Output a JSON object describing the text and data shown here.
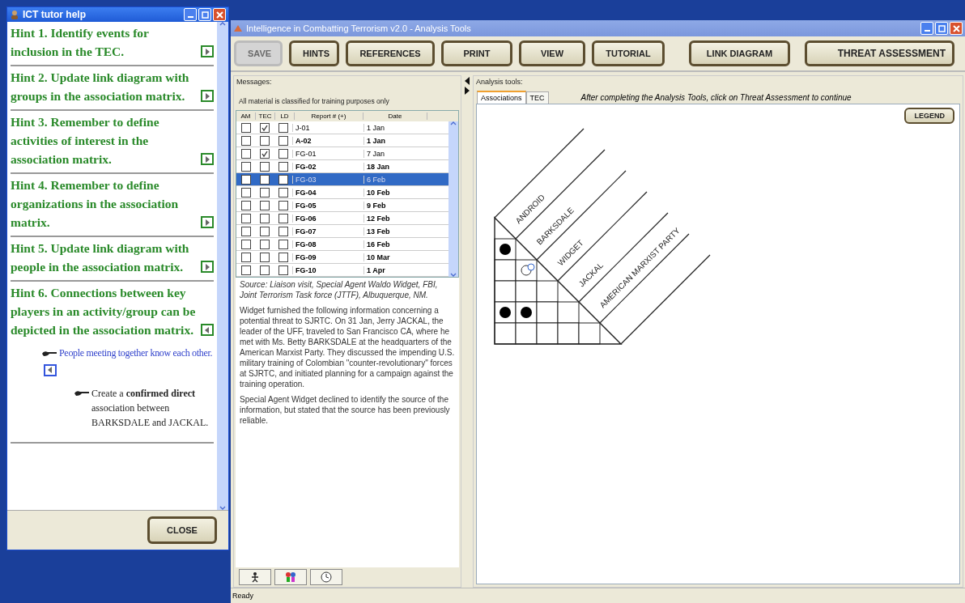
{
  "tutor_window": {
    "title": "ICT tutor help",
    "close_button": "CLOSE",
    "hints": [
      {
        "text": "Hint 1. Identify events for inclusion in the TEC.",
        "kind": "forward"
      },
      {
        "text": "Hint 2. Update link diagram with groups in the association matrix.",
        "kind": "forward"
      },
      {
        "text": "Hint 3. Remember to define activities of interest in the association matrix.",
        "kind": "forward"
      },
      {
        "text": "Hint 4. Remember to define organizations in the association matrix.",
        "kind": "forward"
      },
      {
        "text": "Hint 5. Update link diagram with people in the association matrix.",
        "kind": "forward"
      },
      {
        "text": "Hint 6. Connections between key players in an activity/group can be depicted in the association matrix.",
        "kind": "back",
        "children": [
          {
            "text": "People meeting together know each other.",
            "kind": "back",
            "children": [
              {
                "text": "Create a **confirmed direct** association between BARKSDALE and JACKAL."
              }
            ]
          }
        ]
      }
    ]
  },
  "main_window": {
    "title": "Intelligence in Combatting Terrorism v2.0 - Analysis Tools",
    "toolbar": [
      {
        "label": "SAVE",
        "disabled": true
      },
      {
        "label": "HINTS",
        "disabled": false
      },
      {
        "label": "REFERENCES",
        "disabled": false
      },
      {
        "label": "PRINT",
        "disabled": false
      },
      {
        "label": "VIEW",
        "disabled": false
      },
      {
        "label": "TUTORIAL",
        "disabled": false
      },
      {
        "label": "LINK DIAGRAM",
        "disabled": false
      },
      {
        "label": "THREAT ASSESSMENT",
        "disabled": false
      }
    ],
    "messages": {
      "title": "Messages:",
      "notice": "All material is classified for training purposes only",
      "columns": [
        "AM",
        "TEC",
        "LD",
        "Report # (+)",
        "Date"
      ],
      "rows": [
        {
          "am": false,
          "tec": true,
          "ld": false,
          "report": "J-01",
          "date": "1 Jan",
          "unread": false,
          "selected": false
        },
        {
          "am": false,
          "tec": false,
          "ld": false,
          "report": "A-02",
          "date": "1 Jan",
          "unread": true,
          "selected": false
        },
        {
          "am": false,
          "tec": true,
          "ld": false,
          "report": "FG-01",
          "date": "7 Jan",
          "unread": false,
          "selected": false
        },
        {
          "am": false,
          "tec": false,
          "ld": false,
          "report": "FG-02",
          "date": "18 Jan",
          "unread": true,
          "selected": false
        },
        {
          "am": false,
          "tec": false,
          "ld": false,
          "report": "FG-03",
          "date": "6 Feb",
          "unread": false,
          "selected": true
        },
        {
          "am": false,
          "tec": false,
          "ld": false,
          "report": "FG-04",
          "date": "10 Feb",
          "unread": true,
          "selected": false
        },
        {
          "am": false,
          "tec": false,
          "ld": false,
          "report": "FG-05",
          "date": "9 Feb",
          "unread": true,
          "selected": false
        },
        {
          "am": false,
          "tec": false,
          "ld": false,
          "report": "FG-06",
          "date": "12 Feb",
          "unread": true,
          "selected": false
        },
        {
          "am": false,
          "tec": false,
          "ld": false,
          "report": "FG-07",
          "date": "13 Feb",
          "unread": true,
          "selected": false
        },
        {
          "am": false,
          "tec": false,
          "ld": false,
          "report": "FG-08",
          "date": "16 Feb",
          "unread": true,
          "selected": false
        },
        {
          "am": false,
          "tec": false,
          "ld": false,
          "report": "FG-09",
          "date": "10 Mar",
          "unread": true,
          "selected": false
        },
        {
          "am": false,
          "tec": false,
          "ld": false,
          "report": "FG-10",
          "date": "1 Apr",
          "unread": true,
          "selected": false
        }
      ],
      "body": [
        {
          "text": "Source: Liaison visit, Special Agent Waldo Widget, FBI, Joint Terrorism Task force (JTTF), Albuquerque, NM.",
          "kind": "source"
        },
        {
          "text": "Widget furnished the following information concerning a potential threat to SJRTC.  On 31 Jan, Jerry JACKAL, the leader of the UFF, traveled to San Francisco CA, where he met with Ms. Betty BARKSDALE at the headquarters of the American Marxist Party. They discussed the impending U.S. military training of Colombian \"counter-revolutionary\" forces at SJRTC, and initiated planning for a campaign against the training operation.",
          "kind": "body"
        },
        {
          "text": "Special Agent Widget declined to identify the source of the information, but stated that the source has been previously reliable.",
          "kind": "body"
        }
      ]
    },
    "analysis": {
      "title": "Analysis tools:",
      "tabs": [
        {
          "label": "Associations",
          "selected": true
        },
        {
          "label": "TEC",
          "selected": false
        }
      ],
      "instruction": "After completing the Analysis Tools, click on Threat Assessment to continue",
      "legend_button": "LEGEND",
      "entities": [
        "ANDROID",
        "BARKSDALE",
        "WIDGET",
        "JACKAL",
        "AMERICAN MARXIST PARTY"
      ],
      "matrix_rows": [
        [
          {
            "marked": true
          }
        ],
        [
          {
            "marked": false
          },
          {
            "marked": false
          }
        ],
        [
          {
            "marked": false
          },
          {
            "marked": false
          },
          {
            "marked": false
          }
        ],
        [
          {
            "marked": true
          },
          {
            "marked": true
          },
          {
            "marked": false
          },
          {
            "marked": false
          }
        ],
        [
          {
            "marked": false
          },
          {
            "marked": false
          },
          {
            "marked": false
          },
          {
            "marked": false
          },
          {
            "marked": false
          }
        ]
      ]
    },
    "status_bar": "Ready"
  }
}
